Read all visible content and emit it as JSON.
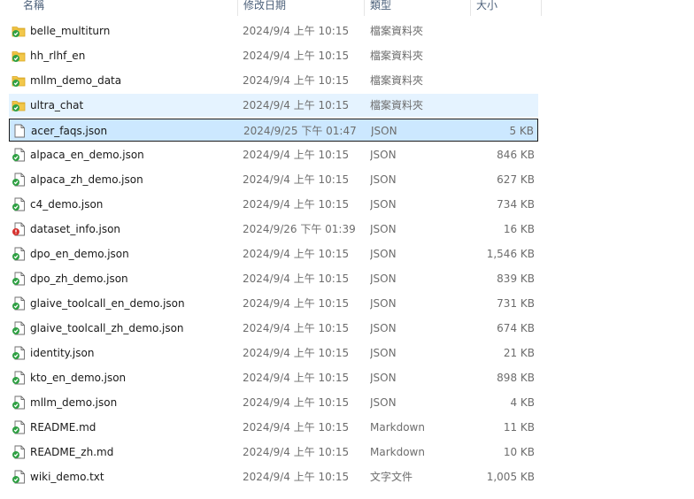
{
  "columns": {
    "name": "名稱",
    "date": "修改日期",
    "type": "類型",
    "size": "大小"
  },
  "colors": {
    "folder": "#f2c84b",
    "folder_dark": "#d9a520",
    "check": "#2fa043",
    "error": "#d6322e",
    "hover": "#e5f3ff",
    "selected": "#cce8ff"
  },
  "files": [
    {
      "name": "belle_multiturn",
      "date": "2024/9/4 上午 10:15",
      "type": "檔案資料夾",
      "size": "",
      "icon": "folder-synced-icon",
      "state": ""
    },
    {
      "name": "hh_rlhf_en",
      "date": "2024/9/4 上午 10:15",
      "type": "檔案資料夾",
      "size": "",
      "icon": "folder-synced-icon",
      "state": ""
    },
    {
      "name": "mllm_demo_data",
      "date": "2024/9/4 上午 10:15",
      "type": "檔案資料夾",
      "size": "",
      "icon": "folder-synced-icon",
      "state": ""
    },
    {
      "name": "ultra_chat",
      "date": "2024/9/4 上午 10:15",
      "type": "檔案資料夾",
      "size": "",
      "icon": "folder-synced-icon",
      "state": "hover"
    },
    {
      "name": "acer_faqs.json",
      "date": "2024/9/25 下午 01:47",
      "type": "JSON",
      "size": "5 KB",
      "icon": "file-icon",
      "state": "selected"
    },
    {
      "name": "alpaca_en_demo.json",
      "date": "2024/9/4 上午 10:15",
      "type": "JSON",
      "size": "846 KB",
      "icon": "file-synced-icon",
      "state": ""
    },
    {
      "name": "alpaca_zh_demo.json",
      "date": "2024/9/4 上午 10:15",
      "type": "JSON",
      "size": "627 KB",
      "icon": "file-synced-icon",
      "state": ""
    },
    {
      "name": "c4_demo.json",
      "date": "2024/9/4 上午 10:15",
      "type": "JSON",
      "size": "734 KB",
      "icon": "file-synced-icon",
      "state": ""
    },
    {
      "name": "dataset_info.json",
      "date": "2024/9/26 下午 01:39",
      "type": "JSON",
      "size": "16 KB",
      "icon": "file-error-icon",
      "state": ""
    },
    {
      "name": "dpo_en_demo.json",
      "date": "2024/9/4 上午 10:15",
      "type": "JSON",
      "size": "1,546 KB",
      "icon": "file-synced-icon",
      "state": ""
    },
    {
      "name": "dpo_zh_demo.json",
      "date": "2024/9/4 上午 10:15",
      "type": "JSON",
      "size": "839 KB",
      "icon": "file-synced-icon",
      "state": ""
    },
    {
      "name": "glaive_toolcall_en_demo.json",
      "date": "2024/9/4 上午 10:15",
      "type": "JSON",
      "size": "731 KB",
      "icon": "file-synced-icon",
      "state": ""
    },
    {
      "name": "glaive_toolcall_zh_demo.json",
      "date": "2024/9/4 上午 10:15",
      "type": "JSON",
      "size": "674 KB",
      "icon": "file-synced-icon",
      "state": ""
    },
    {
      "name": "identity.json",
      "date": "2024/9/4 上午 10:15",
      "type": "JSON",
      "size": "21 KB",
      "icon": "file-synced-icon",
      "state": ""
    },
    {
      "name": "kto_en_demo.json",
      "date": "2024/9/4 上午 10:15",
      "type": "JSON",
      "size": "898 KB",
      "icon": "file-synced-icon",
      "state": ""
    },
    {
      "name": "mllm_demo.json",
      "date": "2024/9/4 上午 10:15",
      "type": "JSON",
      "size": "4 KB",
      "icon": "file-synced-icon",
      "state": ""
    },
    {
      "name": "README.md",
      "date": "2024/9/4 上午 10:15",
      "type": "Markdown",
      "size": "11 KB",
      "icon": "file-synced-icon",
      "state": ""
    },
    {
      "name": "README_zh.md",
      "date": "2024/9/4 上午 10:15",
      "type": "Markdown",
      "size": "10 KB",
      "icon": "file-synced-icon",
      "state": ""
    },
    {
      "name": "wiki_demo.txt",
      "date": "2024/9/4 上午 10:15",
      "type": "文字文件",
      "size": "1,005 KB",
      "icon": "file-synced-icon",
      "state": ""
    }
  ]
}
